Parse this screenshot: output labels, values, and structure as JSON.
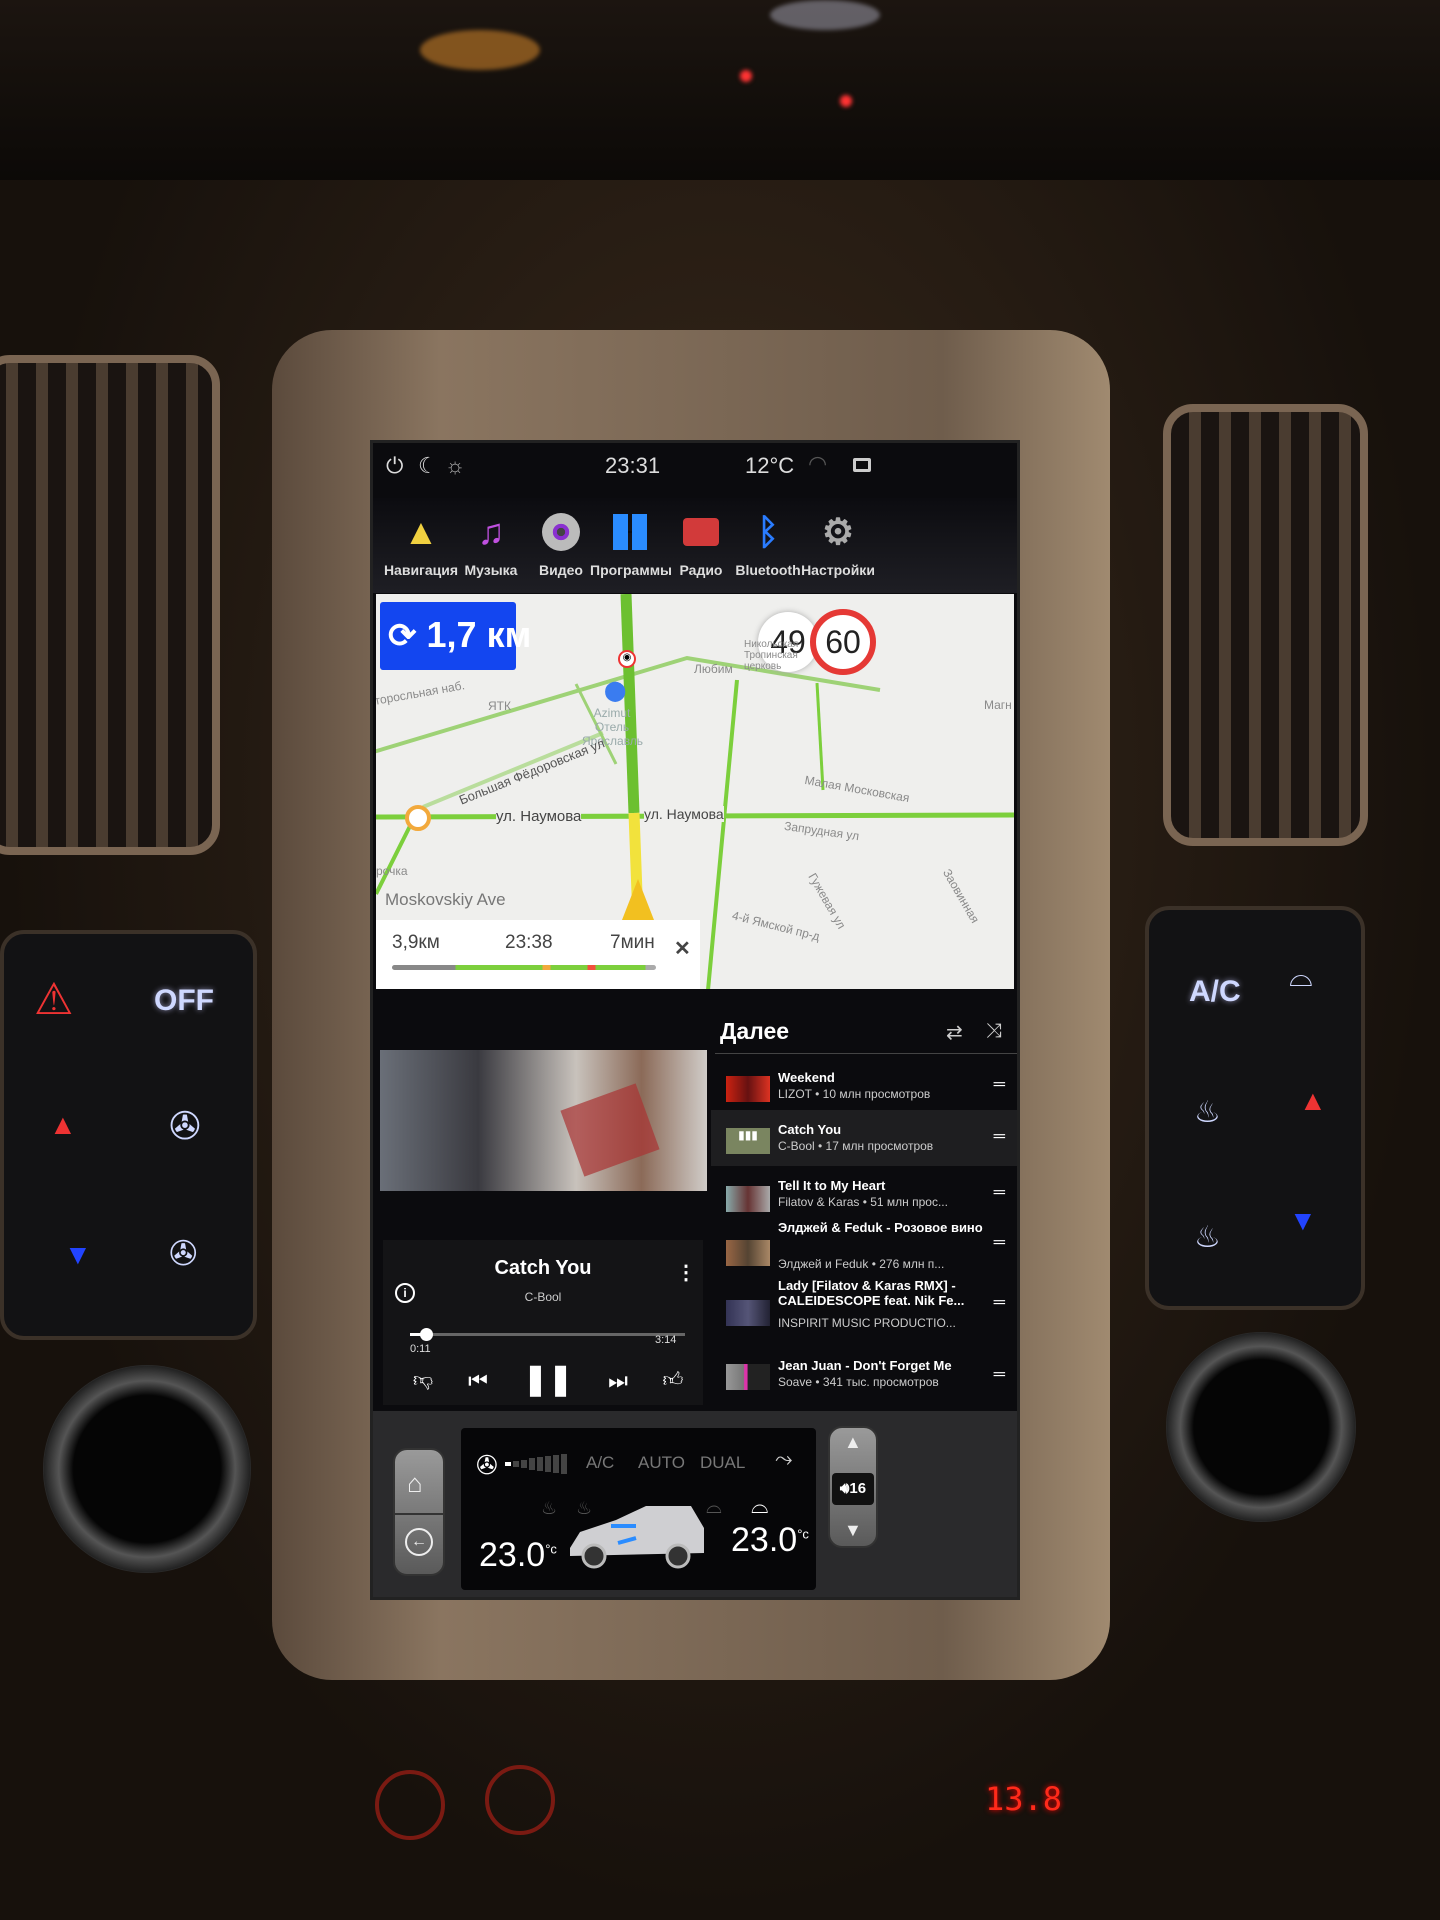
{
  "status_bar": {
    "time": "23:31",
    "temperature": "12°C",
    "icons": [
      "power-icon",
      "night-mode-icon",
      "brightness-icon",
      "wifi-icon",
      "multiwindow-icon"
    ]
  },
  "apps": [
    {
      "label": "Навигация",
      "icon": "navigation-arrow-icon"
    },
    {
      "label": "Музыка",
      "icon": "music-note-icon"
    },
    {
      "label": "Видео",
      "icon": "video-reel-icon"
    },
    {
      "label": "Программы",
      "icon": "apps-grid-icon"
    },
    {
      "label": "Радио",
      "icon": "radio-icon"
    },
    {
      "label": "Bluetooth",
      "icon": "bluetooth-icon"
    },
    {
      "label": "Настройки",
      "icon": "gear-icon"
    }
  ],
  "navigation": {
    "maneuver_distance": "1,7 км",
    "maneuver_icon": "roundabout-icon",
    "current_speed": "49",
    "speed_limit": "60",
    "current_street": "Moskovskiy Ave",
    "remaining_distance": "3,9км",
    "arrival_time": "23:38",
    "remaining_time": "7мин",
    "close": "✕",
    "map_labels": {
      "naberezhnaya": "торосльная наб.",
      "yatk": "ЯТК",
      "hotel": "Azimut Отель Ярославль",
      "fedorovskaya": "Большая Фёдоровская ул",
      "naumova1": "ул. Наумова",
      "naumova2": "ул. Наумова",
      "malaya": "Малая Московская",
      "zaprudnaya": "Запрудная ул",
      "guzhevaya": "Гужевая ул",
      "yamskoy": "4-й Ямской пр-д",
      "zaovinnaya": "Заовинная",
      "lyubim": "Любим",
      "church": "Никольская Тропинская церковь",
      "magnit": "Магн",
      "pyaterochka": "рочка"
    },
    "colors": {
      "route": "#7ccf3c",
      "slow": "#f2e23c",
      "maneuver_bg": "#1346f0",
      "limit_ring": "#e53935"
    }
  },
  "queue": {
    "title": "Далее",
    "items": [
      {
        "title": "Weekend",
        "subtitle": "LIZOT • 10 млн просмотров"
      },
      {
        "title": "Catch You",
        "subtitle": "C-Bool • 17 млн просмотров",
        "playing": true
      },
      {
        "title": "Tell It to My Heart",
        "subtitle": "Filatov & Karas • 51 млн прос..."
      },
      {
        "title": "Элджей & Feduk - Розовое вино",
        "subtitle": "Элджей и Feduk • 276 млн п..."
      },
      {
        "title": "Lady [Filatov & Karas RMX] - CALEIDESCOPE feat. Nik Fe...",
        "subtitle": "INSPIRIT MUSIC PRODUCTIO..."
      },
      {
        "title": "Jean Juan - Don't Forget Me",
        "subtitle": "Soave • 341 тыс. просмотров"
      }
    ]
  },
  "player": {
    "title": "Catch You",
    "artist": "C-Bool",
    "elapsed": "0:11",
    "duration": "3:14",
    "progress_fraction": 0.057,
    "state": "playing"
  },
  "climate": {
    "ac": "A/C",
    "auto": "AUTO",
    "dual": "DUAL",
    "left_temp": "23.0",
    "right_temp": "23.0",
    "unit": "°c",
    "fan_level": 1,
    "fan_levels": 8,
    "volume": "16"
  },
  "hardware": {
    "off": "OFF",
    "ac": "A/C",
    "voltage": "13.8"
  }
}
